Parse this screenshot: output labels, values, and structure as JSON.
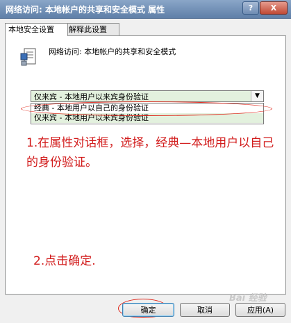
{
  "window": {
    "title": "网络访问: 本地帐户的共享和安全模式 属性",
    "help_label": "?",
    "close_label": "X"
  },
  "tabs": [
    {
      "label": "本地安全设置",
      "active": true
    },
    {
      "label": "解释此设置",
      "active": false
    }
  ],
  "policy": {
    "title": "网络访问: 本地帐户的共享和安全模式",
    "icon": "policy-document-icon"
  },
  "select": {
    "selected": "仅来宾 - 本地用户以来宾身份验证",
    "arrow": "▼",
    "options": [
      "经典 - 本地用户以自己的身份验证",
      "仅来宾 - 本地用户以来宾身份验证"
    ]
  },
  "annotations": {
    "step1": "1.在属性对话框，选择，经典—本地用户以自己的身份验证。",
    "step2": "2.点击确定."
  },
  "buttons": {
    "ok": "确定",
    "cancel": "取消",
    "apply": "应用(A)"
  },
  "watermark": "Bai 经验",
  "colors": {
    "annotation": "#d21c1c",
    "selected_bg": "#e3f1de"
  }
}
